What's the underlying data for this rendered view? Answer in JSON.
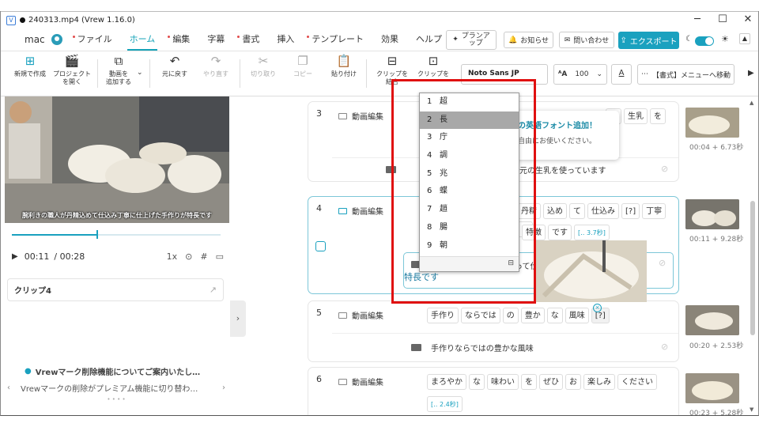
{
  "window": {
    "title": "240313.mp4 (Vrew 1.16.0)",
    "minimize": "─",
    "maximize": "☐",
    "close": "✕"
  },
  "menubar": {
    "user": "mac",
    "items": [
      "ファイル",
      "ホーム",
      "編集",
      "字幕",
      "書式",
      "挿入",
      "テンプレート",
      "効果",
      "ヘルプ"
    ],
    "plan_up": "プランアップ",
    "notifications": "お知らせ",
    "contact": "問い合わせ",
    "export": "エクスポート"
  },
  "toolbar": {
    "new_project": "新規で作成",
    "open_project_1": "プロジェクト",
    "open_project_2": "を開く",
    "add_video_1": "動画を",
    "add_video_2": "追加する",
    "undo": "元に戻す",
    "redo": "やり直す",
    "cut": "切り取り",
    "copy": "コピー",
    "paste": "貼り付け",
    "merge_clip_1": "クリップを",
    "merge_clip_2": "結合",
    "split_clip": "クリップを",
    "font": "Noto Sans JP",
    "font_size": "100",
    "format_menu": "【書式】メニューへ移動"
  },
  "player": {
    "subtitle": "腕利きの職人が丹精込めて仕込み丁寧に仕上げた手作りが特長です",
    "time_current": "00:11",
    "time_total": "/ 00:28",
    "speed": "1x",
    "progress": 0.41
  },
  "clip_panel": {
    "title": "クリップ4"
  },
  "notice": {
    "title": "Vrewマーク削除機能についてご案内いたし…",
    "body": "Vrewマークの削除がプレミアム機能に切り替わ…"
  },
  "clips": [
    {
      "num": "3",
      "label": "動画編集",
      "words_a": [
        "の",
        "生乳",
        "を"
      ],
      "sub": "した地元の生乳を使っています",
      "time": "00:04 + 6.73秒"
    },
    {
      "num": "4",
      "label": "動画編集",
      "words_a": [
        "丹精",
        "込め",
        "て",
        "仕込み",
        "[?]",
        "丁寧",
        "に"
      ],
      "words_b": [
        "特徴",
        "です",
        "[‥ 3.7秒]"
      ],
      "sub_tail": "って仕",
      "ime": "特長です",
      "time": "00:11 + 9.28秒"
    },
    {
      "num": "5",
      "label": "動画編集",
      "words_a": [
        "手作り",
        "ならでは",
        "の",
        "豊か",
        "な",
        "風味",
        "[?]"
      ],
      "sub": "手作りならではの豊かな風味",
      "time": "00:20 + 2.53秒"
    },
    {
      "num": "6",
      "label": "動画編集",
      "words_a": [
        "まろやか",
        "な",
        "味わい",
        "を",
        "ぜひ",
        "お",
        "楽しみ",
        "ください"
      ],
      "words_b": [
        "[‥ 2.4秒]"
      ],
      "time": "00:23 + 5.28秒"
    }
  ],
  "candidates": [
    {
      "n": "1",
      "c": "超"
    },
    {
      "n": "2",
      "c": "長"
    },
    {
      "n": "3",
      "c": "庁"
    },
    {
      "n": "4",
      "c": "調"
    },
    {
      "n": "5",
      "c": "兆"
    },
    {
      "n": "6",
      "c": "蝶"
    },
    {
      "n": "7",
      "c": "趙"
    },
    {
      "n": "8",
      "c": "腸"
    },
    {
      "n": "9",
      "c": "朝"
    }
  ],
  "tooltip": {
    "line1": "の英語フォント追加！",
    "line2": "自由にお使いください。"
  },
  "colors": {
    "accent": "#1aa1bf",
    "highlight_box": "#e01010"
  }
}
